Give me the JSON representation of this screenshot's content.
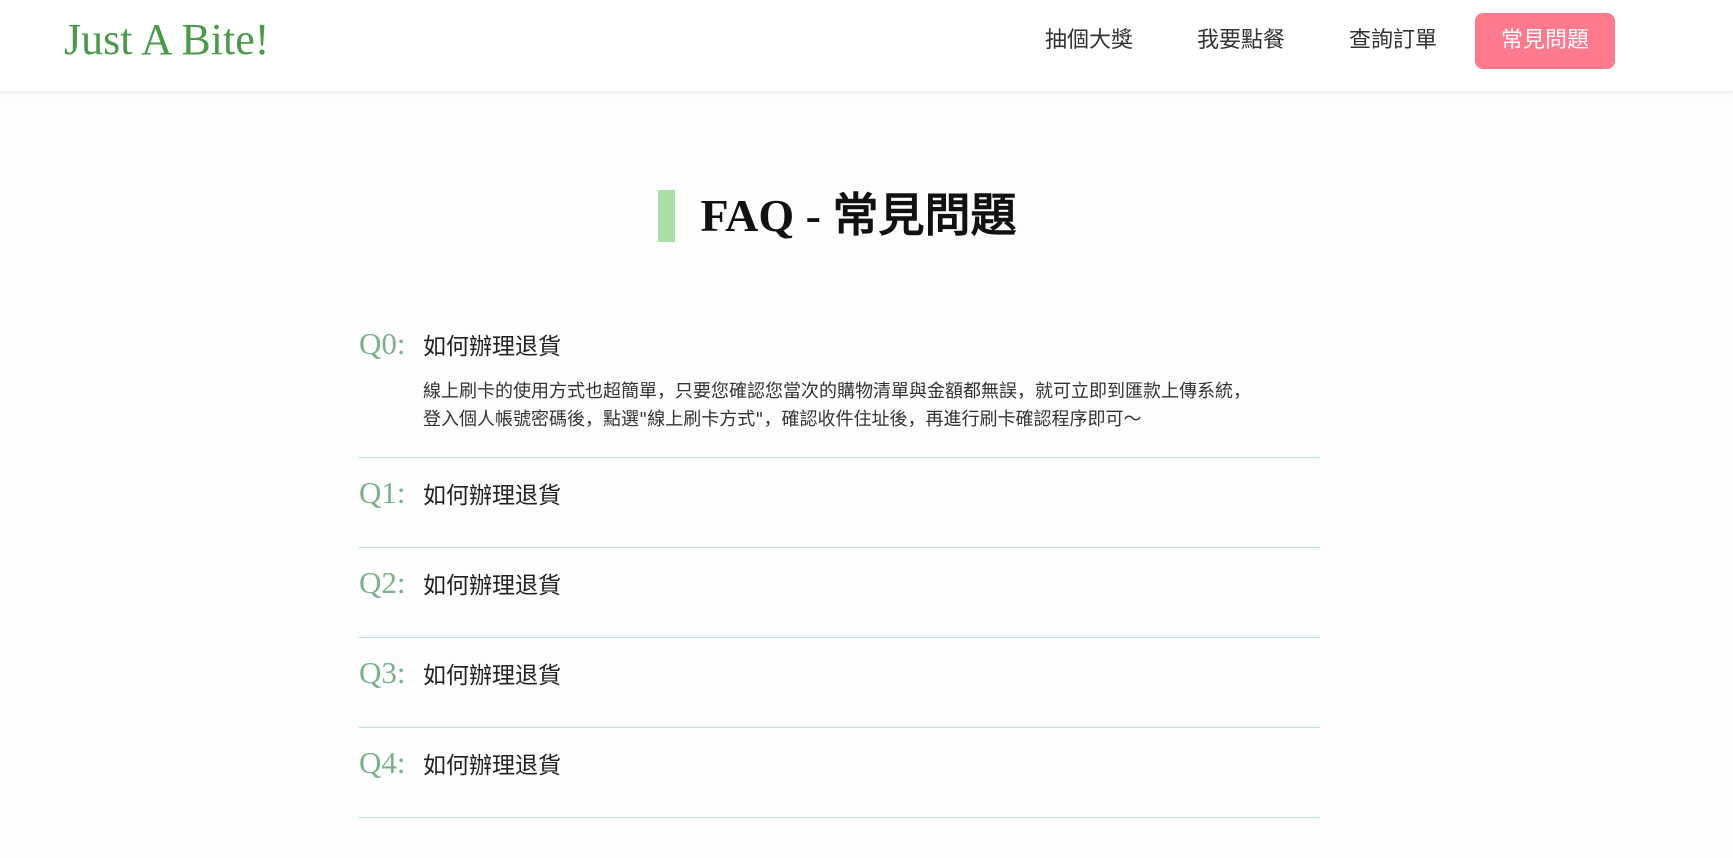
{
  "header": {
    "logo": "Just A Bite!",
    "nav": [
      {
        "label": "抽個大獎"
      },
      {
        "label": "我要點餐"
      },
      {
        "label": "查詢訂單"
      },
      {
        "label": "常見問題",
        "active": true
      }
    ]
  },
  "main": {
    "title": "FAQ - 常見問題",
    "faq": [
      {
        "num": "Q0:",
        "question": "如何辦理退貨",
        "answer": "線上刷卡的使用方式也超簡單，只要您確認您當次的購物清單與金額都無誤，就可立即到匯款上傳系統，登入個人帳號密碼後，點選\"線上刷卡方式\"，確認收件住址後，再進行刷卡確認程序即可～"
      },
      {
        "num": "Q1:",
        "question": "如何辦理退貨"
      },
      {
        "num": "Q2:",
        "question": "如何辦理退貨"
      },
      {
        "num": "Q3:",
        "question": "如何辦理退貨"
      },
      {
        "num": "Q4:",
        "question": "如何辦理退貨"
      }
    ]
  },
  "colors": {
    "logo": "#4a9a4a",
    "active_nav_bg": "#ff7a8c",
    "heading_bar": "#a8dfa5",
    "question_number": "#7ab28d",
    "divider": "#b7e3cf"
  }
}
